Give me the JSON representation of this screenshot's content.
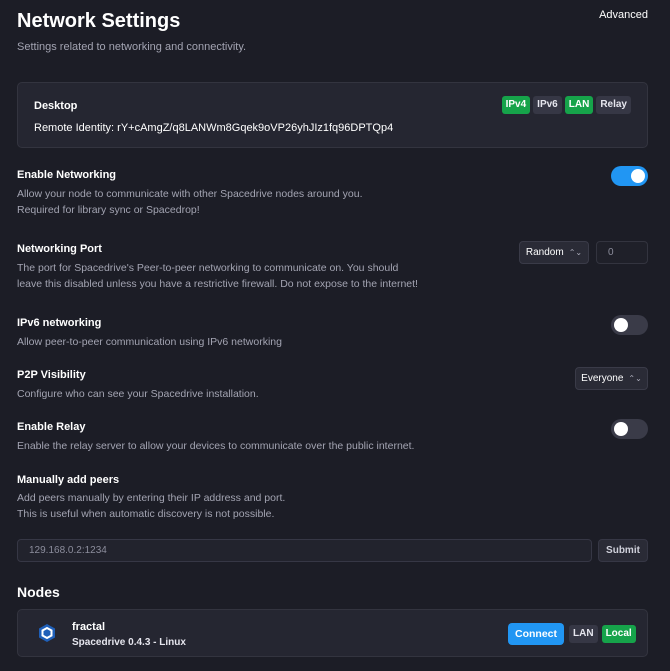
{
  "header": {
    "title": "Network Settings",
    "subtitle": "Settings related to networking and connectivity.",
    "advanced_label": "Advanced"
  },
  "device": {
    "name": "Desktop",
    "remote_identity": "Remote Identity: rY+cAmgZ/q8LANWm8Gqek9oVP26yhJIz1fq96DPTQp4",
    "badges": [
      "IPv4",
      "IPv6",
      "LAN",
      "Relay"
    ]
  },
  "enable_networking": {
    "title": "Enable Networking",
    "desc_line1": "Allow your node to communicate with other Spacedrive nodes around you.",
    "desc_line2": "Required for library sync or Spacedrop!",
    "enabled": true
  },
  "networking_port": {
    "title": "Networking Port",
    "desc_line1": "The port for Spacedrive's Peer-to-peer networking to communicate on. You should",
    "desc_line2": "leave this disabled unless you have a restrictive firewall. Do not expose to the internet!",
    "mode": "Random",
    "port_placeholder": "0"
  },
  "ipv6": {
    "title": "IPv6 networking",
    "desc": "Allow peer-to-peer communication using IPv6 networking",
    "enabled": false
  },
  "p2p_visibility": {
    "title": "P2P Visibility",
    "desc": "Configure who can see your Spacedrive installation.",
    "value": "Everyone"
  },
  "enable_relay": {
    "title": "Enable Relay",
    "desc": "Enable the relay server to allow your devices to communicate over the public internet.",
    "enabled": false
  },
  "manual_peers": {
    "title": "Manually add peers",
    "desc_line1": "Add peers manually by entering their IP address and port.",
    "desc_line2": "This is useful when automatic discovery is not possible.",
    "input_placeholder": "129.168.0.2:1234",
    "submit_label": "Submit"
  },
  "nodes": {
    "title": "Nodes",
    "items": [
      {
        "name": "fractal",
        "version": "Spacedrive 0.4.3 - Linux",
        "connect_label": "Connect",
        "badges": [
          "LAN",
          "Local"
        ]
      }
    ]
  },
  "colors": {
    "background": "#1c1d26",
    "accent": "#2196f3",
    "badge_green": "#16a34a"
  }
}
